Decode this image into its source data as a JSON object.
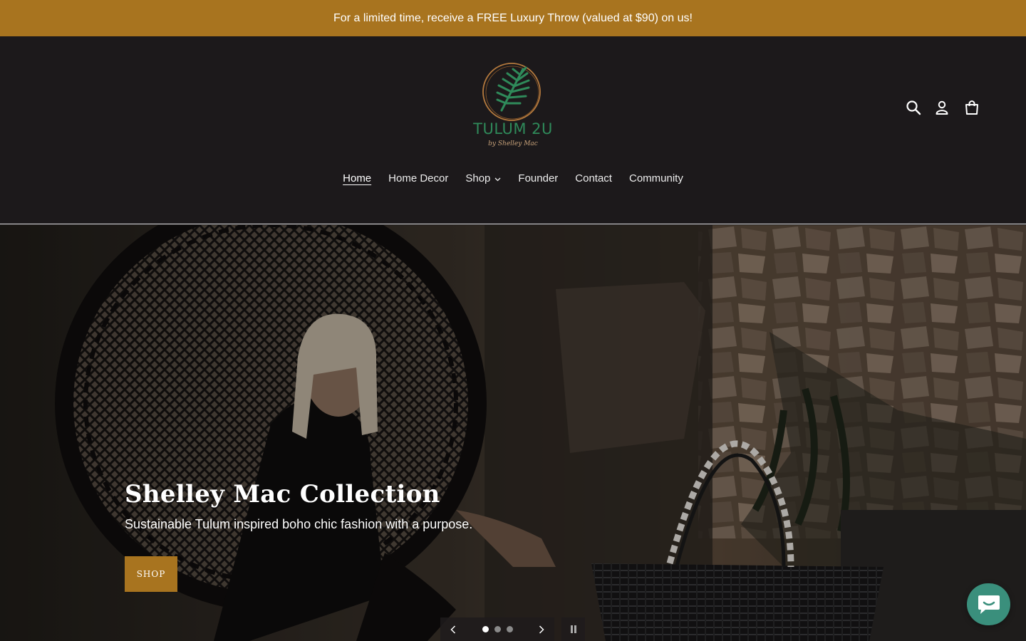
{
  "announcement": {
    "text": "For a limited time, receive a FREE Luxury Throw (valued at $90) on us!"
  },
  "header": {
    "logo": {
      "text": "TULUM 2U",
      "subtext": "by Shelley Mac"
    },
    "icons": [
      "search-icon",
      "account-icon",
      "cart-icon"
    ]
  },
  "nav": {
    "items": [
      {
        "label": "Home",
        "active": true
      },
      {
        "label": "Home Decor"
      },
      {
        "label": "Shop",
        "has_dropdown": true
      },
      {
        "label": "Founder"
      },
      {
        "label": "Contact"
      },
      {
        "label": "Community"
      }
    ]
  },
  "hero": {
    "title": "Shelley Mac Collection",
    "subtitle": "Sustainable Tulum inspired boho chic fashion with a purpose.",
    "button_label": "SHOP",
    "slide_count": 3,
    "active_slide": 1
  },
  "colors": {
    "accent": "#a8741f",
    "header_bg": "#1c191b",
    "chat_button": "#3a8f7c",
    "logo_green": "#2f8a5a"
  }
}
